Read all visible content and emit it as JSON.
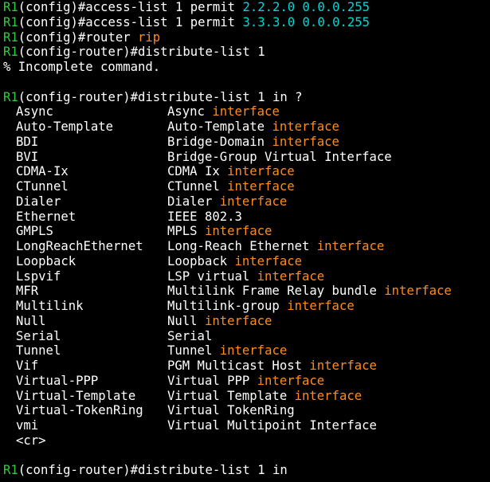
{
  "colors": {
    "prompt": "#2ecc40",
    "text": "#ffffff",
    "address": "#00d7d7",
    "keyword": "#ff8c1a",
    "background": "#000000"
  },
  "lines": [
    {
      "type": "cmd",
      "host": "R1",
      "mode": "(config)#",
      "segments": [
        {
          "t": "access-list 1 permit ",
          "c": "text"
        },
        {
          "t": "2.2.2.0 0.0.0.255",
          "c": "address"
        }
      ]
    },
    {
      "type": "cmd",
      "host": "R1",
      "mode": "(config)#",
      "segments": [
        {
          "t": "access-list 1 permit ",
          "c": "text"
        },
        {
          "t": "3.3.3.0 0.0.0.255",
          "c": "address"
        }
      ]
    },
    {
      "type": "cmd",
      "host": "R1",
      "mode": "(config)#",
      "segments": [
        {
          "t": "router ",
          "c": "text"
        },
        {
          "t": "rip",
          "c": "keyword"
        }
      ]
    },
    {
      "type": "cmd",
      "host": "R1",
      "mode": "(config-router)#",
      "segments": [
        {
          "t": "distribute-list 1",
          "c": "text"
        }
      ]
    },
    {
      "type": "text",
      "text": "% Incomplete command."
    },
    {
      "type": "blank"
    },
    {
      "type": "cmd",
      "host": "R1",
      "mode": "(config-router)#",
      "segments": [
        {
          "t": "distribute-list 1 in ?",
          "c": "text"
        }
      ]
    },
    {
      "type": "help",
      "name": "Async",
      "desc": "Async",
      "suffix": "interface"
    },
    {
      "type": "help",
      "name": "Auto-Template",
      "desc": "Auto-Template",
      "suffix": "interface"
    },
    {
      "type": "help",
      "name": "BDI",
      "desc": "Bridge-Domain",
      "suffix": "interface"
    },
    {
      "type": "help",
      "name": "BVI",
      "desc": "Bridge-Group Virtual Interface",
      "suffix": ""
    },
    {
      "type": "help",
      "name": "CDMA-Ix",
      "desc": "CDMA Ix",
      "suffix": "interface"
    },
    {
      "type": "help",
      "name": "CTunnel",
      "desc": "CTunnel",
      "suffix": "interface"
    },
    {
      "type": "help",
      "name": "Dialer",
      "desc": "Dialer",
      "suffix": "interface"
    },
    {
      "type": "help",
      "name": "Ethernet",
      "desc": "IEEE 802.3",
      "suffix": ""
    },
    {
      "type": "help",
      "name": "GMPLS",
      "desc": "MPLS",
      "suffix": "interface"
    },
    {
      "type": "help",
      "name": "LongReachEthernet",
      "desc": "Long-Reach Ethernet",
      "suffix": "interface"
    },
    {
      "type": "help",
      "name": "Loopback",
      "desc": "Loopback",
      "suffix": "interface"
    },
    {
      "type": "help",
      "name": "Lspvif",
      "desc": "LSP virtual",
      "suffix": "interface"
    },
    {
      "type": "help",
      "name": "MFR",
      "desc": "Multilink Frame Relay bundle",
      "suffix": "interface"
    },
    {
      "type": "help",
      "name": "Multilink",
      "desc": "Multilink-group",
      "suffix": "interface"
    },
    {
      "type": "help",
      "name": "Null",
      "desc": "Null",
      "suffix": "interface"
    },
    {
      "type": "help",
      "name": "Serial",
      "desc": "Serial",
      "suffix": ""
    },
    {
      "type": "help",
      "name": "Tunnel",
      "desc": "Tunnel",
      "suffix": "interface"
    },
    {
      "type": "help",
      "name": "Vif",
      "desc": "PGM Multicast Host",
      "suffix": "interface"
    },
    {
      "type": "help",
      "name": "Virtual-PPP",
      "desc": "Virtual PPP",
      "suffix": "interface"
    },
    {
      "type": "help",
      "name": "Virtual-Template",
      "desc": "Virtual Template",
      "suffix": "interface"
    },
    {
      "type": "help",
      "name": "Virtual-TokenRing",
      "desc": "Virtual TokenRing",
      "suffix": ""
    },
    {
      "type": "help",
      "name": "vmi",
      "desc": "Virtual Multipoint Interface",
      "suffix": ""
    },
    {
      "type": "help",
      "name": "<cr>",
      "desc": "",
      "suffix": ""
    },
    {
      "type": "blank"
    },
    {
      "type": "cmd",
      "host": "R1",
      "mode": "(config-router)#",
      "segments": [
        {
          "t": "distribute-list 1 in",
          "c": "text"
        }
      ]
    }
  ]
}
